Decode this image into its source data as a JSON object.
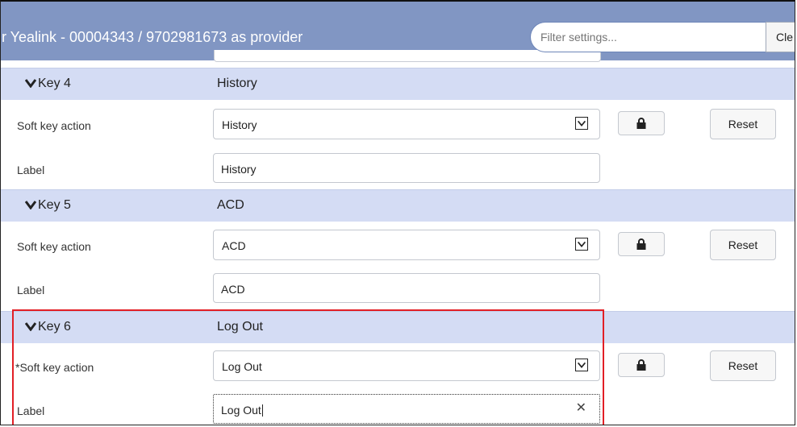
{
  "header": {
    "title": "r Yealink - 00004343 / 9702981673 as provider",
    "filter_placeholder": "Filter settings...",
    "clear_label": "Cle"
  },
  "keys": [
    {
      "name": "Key 4",
      "value": "History",
      "soft_key_label": "Soft key action",
      "soft_key_value": "History",
      "label_label": "Label",
      "label_value": "History"
    },
    {
      "name": "Key 5",
      "value": "ACD",
      "soft_key_label": "Soft key action",
      "soft_key_value": "ACD",
      "label_label": "Label",
      "label_value": "ACD"
    },
    {
      "name": "Key 6",
      "value": "Log Out",
      "soft_key_label": "*Soft key action",
      "soft_key_value": "Log Out",
      "label_label": "Label",
      "label_value": "Log Out"
    }
  ],
  "buttons": {
    "reset": "Reset"
  },
  "icons": {
    "caret": "chevron-down-icon",
    "lock": "lock-icon",
    "select_arrow": "chevron-down-icon",
    "clear": "close-icon"
  },
  "colors": {
    "header_bg": "#8196c3",
    "key_header_bg": "#d4dcf4",
    "highlight_border": "#e21f26"
  }
}
